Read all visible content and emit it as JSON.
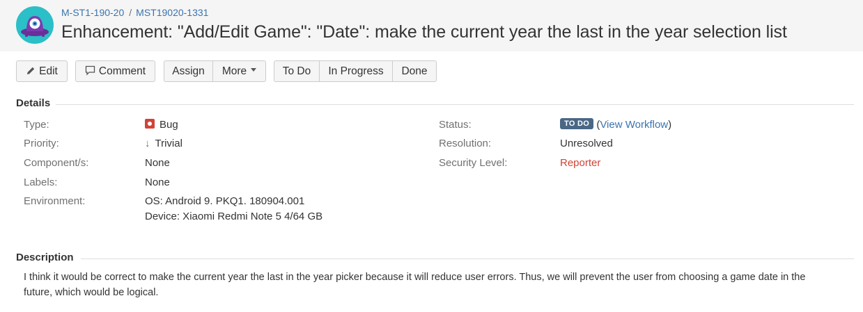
{
  "header": {
    "breadcrumb": [
      "M-ST1-190-20",
      "MST19020-1331"
    ],
    "breadcrumb_separator": "/",
    "title": "Enhancement: \"Add/Edit Game\": \"Date\": make the current year the last in the year selection list",
    "avatar_icon": "project-avatar-icon"
  },
  "toolbar": {
    "edit": "Edit",
    "comment": "Comment",
    "assign": "Assign",
    "more": "More",
    "todo": "To Do",
    "in_progress": "In Progress",
    "done": "Done"
  },
  "details": {
    "heading": "Details",
    "left": [
      {
        "label": "Type:",
        "value": "Bug",
        "icon": "bug-icon"
      },
      {
        "label": "Priority:",
        "value": "Trivial",
        "icon": "arrow-down-icon"
      },
      {
        "label": "Component/s:",
        "value": "None"
      },
      {
        "label": "Labels:",
        "value": "None"
      },
      {
        "label": "Environment:",
        "value_lines": [
          "OS: Android 9. PKQ1. 180904.001",
          "Device: Xiaomi Redmi Note 5 4/64 GB"
        ]
      }
    ],
    "right": {
      "status_label": "Status:",
      "status_value": "TO DO",
      "view_workflow_open": "(",
      "view_workflow": "View Workflow",
      "view_workflow_close": ")",
      "resolution_label": "Resolution:",
      "resolution_value": "Unresolved",
      "security_label": "Security Level:",
      "security_value": "Reporter"
    }
  },
  "description": {
    "heading": "Description",
    "text": "I think it would be correct to make the current year the last in the year picker because it will reduce user errors. Thus, we will prevent the user from choosing a game date in the future, which would be logical."
  },
  "colors": {
    "link": "#3b73af",
    "bug": "#d04437",
    "status_lozenge": "#4a6785",
    "reporter": "#d04437"
  }
}
